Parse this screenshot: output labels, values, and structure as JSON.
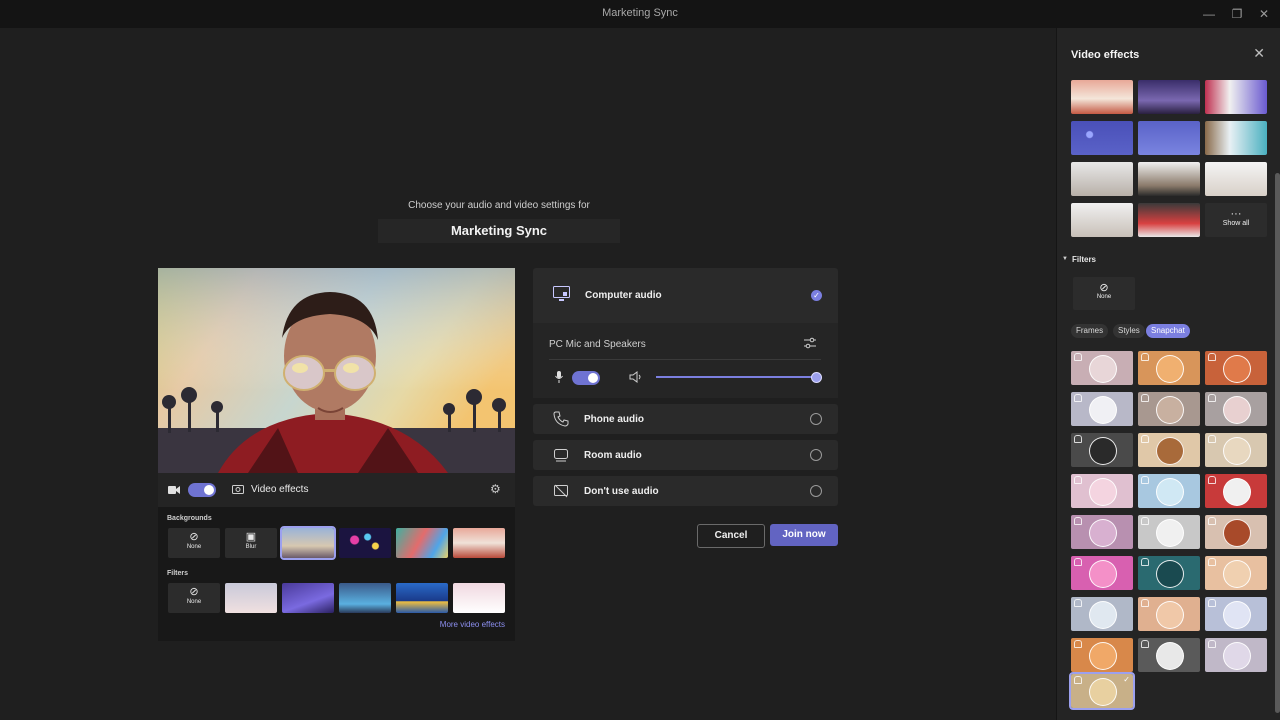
{
  "window": {
    "title": "Marketing Sync"
  },
  "prejoin": {
    "prompt": "Choose your audio and video settings for",
    "meeting_name": "Marketing Sync",
    "video_effects_label": "Video effects",
    "backgrounds_label": "Backgrounds",
    "filters_label": "Filters",
    "none_label": "None",
    "blur_label": "Blur",
    "more_effects_link": "More video effects",
    "camera_on": true
  },
  "audio": {
    "options": [
      {
        "label": "Computer audio",
        "selected": true,
        "icon": "computer-audio-icon"
      },
      {
        "label": "Phone audio",
        "selected": false,
        "icon": "phone-icon"
      },
      {
        "label": "Room audio",
        "selected": false,
        "icon": "room-audio-icon"
      },
      {
        "label": "Don't use audio",
        "selected": false,
        "icon": "no-audio-icon"
      }
    ],
    "device_label": "PC Mic and Speakers",
    "mic_on": true,
    "speaker_volume": 1.0
  },
  "actions": {
    "cancel": "Cancel",
    "join": "Join now"
  },
  "side_panel": {
    "title": "Video effects",
    "show_all_label": "Show all",
    "filters_label": "Filters",
    "none_label": "None",
    "chips": [
      "Frames",
      "Styles",
      "Snapchat"
    ],
    "active_chip": "Snapchat"
  },
  "colors": {
    "accent": "#6f73d2",
    "background": "#1f1f1f",
    "panel": "#242424"
  }
}
